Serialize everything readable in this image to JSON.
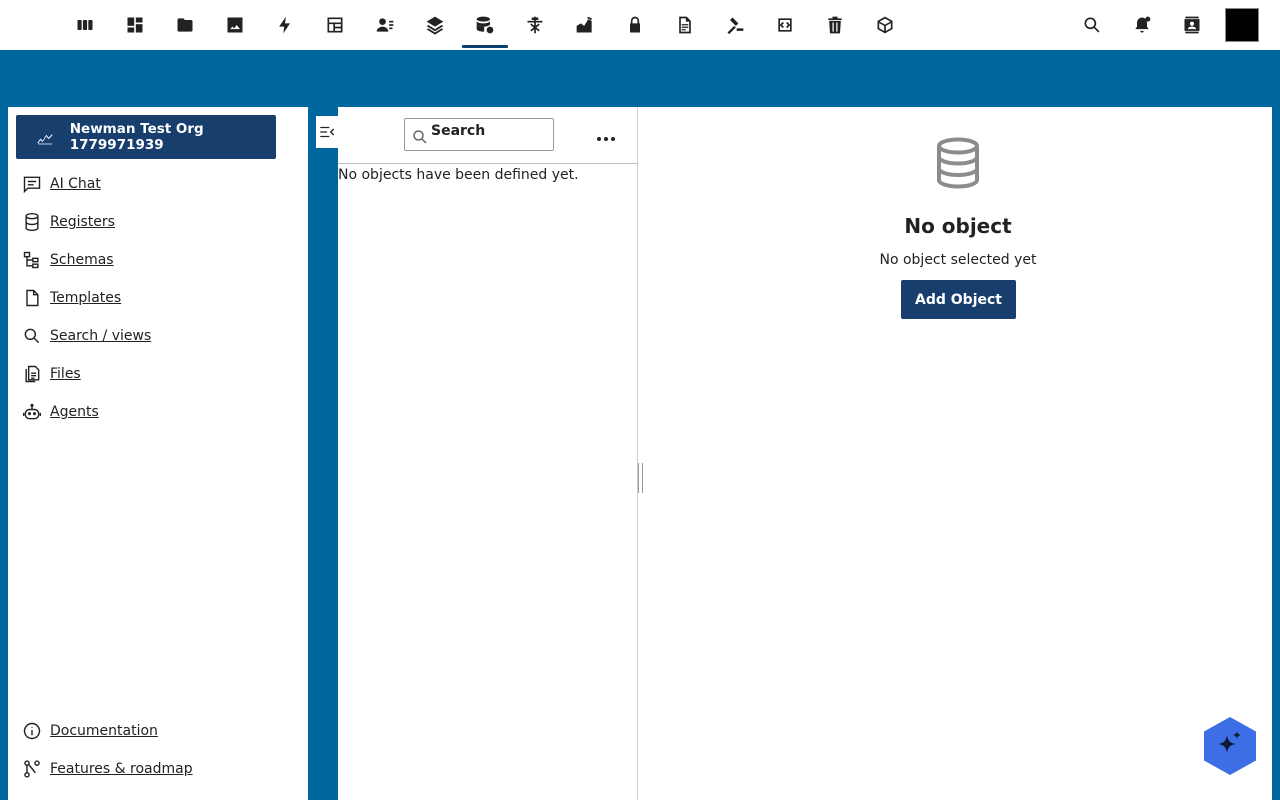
{
  "topbar": {
    "apps": [
      {
        "name": "apps-icon"
      },
      {
        "name": "dashboard-icon"
      },
      {
        "name": "files-icon"
      },
      {
        "name": "photos-icon"
      },
      {
        "name": "activity-icon"
      },
      {
        "name": "tables-icon"
      },
      {
        "name": "contacts-icon"
      },
      {
        "name": "layers-icon"
      },
      {
        "name": "database-settings-icon",
        "active": true
      },
      {
        "name": "tools-icon"
      },
      {
        "name": "chart-icon"
      },
      {
        "name": "lock-icon"
      },
      {
        "name": "document-icon"
      },
      {
        "name": "gavel-icon"
      },
      {
        "name": "code-icon"
      },
      {
        "name": "trash-icon"
      },
      {
        "name": "cube-icon"
      }
    ],
    "right_icons": [
      "search-icon",
      "notifications-icon",
      "contacts-card-icon"
    ]
  },
  "leftnav": {
    "org_label": "Newman Test Org 1779971939",
    "items": [
      {
        "label": "AI Chat",
        "icon": "chat-icon"
      },
      {
        "label": "Registers",
        "icon": "database-icon"
      },
      {
        "label": "Schemas",
        "icon": "schema-icon"
      },
      {
        "label": "Templates",
        "icon": "file-icon"
      },
      {
        "label": "Search / views",
        "icon": "search-icon"
      },
      {
        "label": "Files",
        "icon": "files-icon"
      },
      {
        "label": "Agents",
        "icon": "robot-icon"
      }
    ],
    "footer_items": [
      {
        "label": "Documentation",
        "icon": "info-icon"
      },
      {
        "label": "Features & roadmap",
        "icon": "roadmap-icon"
      }
    ]
  },
  "list": {
    "search_placeholder": "Search",
    "empty_text": "No objects have been defined yet."
  },
  "detail": {
    "title": "No object",
    "subtitle": "No object selected yet",
    "add_button": "Add Object"
  },
  "colors": {
    "brand_blue": "#00679e",
    "button_navy": "#173e6d",
    "fab_blue": "#3d6ee6"
  }
}
